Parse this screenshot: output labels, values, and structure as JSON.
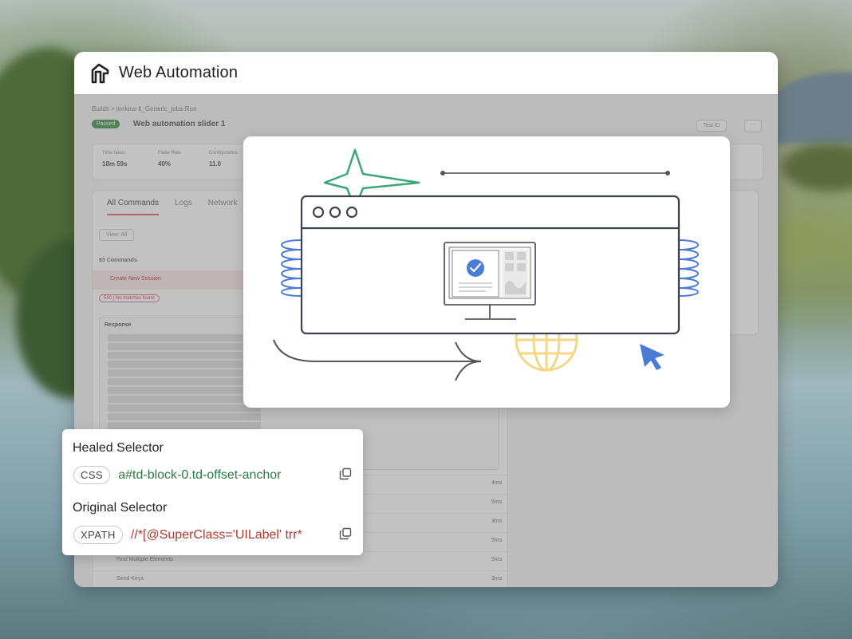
{
  "window": {
    "title": "Web Automation"
  },
  "background_app": {
    "breadcrumb": "Builds  >  jenkins-lt_Generic_jobs-Run",
    "status": "Passed",
    "test_name": "Web automation slider 1",
    "test_id_button": "Test ID",
    "more_button": "···",
    "stats": [
      {
        "label": "Time taken",
        "value": "18m 59s"
      },
      {
        "label": "Flake Rate",
        "value": "40%"
      },
      {
        "label": "Configuration",
        "value": "11.0"
      }
    ],
    "tabs": [
      "All Commands",
      "Logs",
      "Network"
    ],
    "view_select": "View: All",
    "command_count": "83 Commands",
    "error_row": "Create New Session",
    "error_chip": "500 | No matches found",
    "response_heading": "Response",
    "list_rows": [
      {
        "label": "",
        "duration": "4ms"
      },
      {
        "label": "",
        "duration": "5ms"
      },
      {
        "label": "",
        "duration": "3ms"
      },
      {
        "label": "",
        "duration": "5ms"
      },
      {
        "label": "Find Multiple Elements",
        "duration": "5ms"
      },
      {
        "label": "Send Keys",
        "duration": "3ms"
      }
    ]
  },
  "selectors": {
    "healed": {
      "heading": "Healed Selector",
      "type": "CSS",
      "value": "a#td-block-0.td-offset-anchor"
    },
    "original": {
      "heading": "Original Selector",
      "type": "XPATH",
      "value": "//*[@SuperClass='UILabel' trr*"
    }
  },
  "icons": {
    "logo": "lambdatest-logo-icon",
    "copy": "copy-icon",
    "cursor": "cursor-arrow-icon",
    "check": "checkmark-icon",
    "globe": "globe-icon",
    "sparkle": "sparkle-star-icon"
  },
  "colors": {
    "healed_value": "#2d7a43",
    "original_value": "#b13a2f",
    "accent_blue": "#4a7bd6",
    "star_green": "#3aa876",
    "globe_yellow": "#f2d784"
  }
}
